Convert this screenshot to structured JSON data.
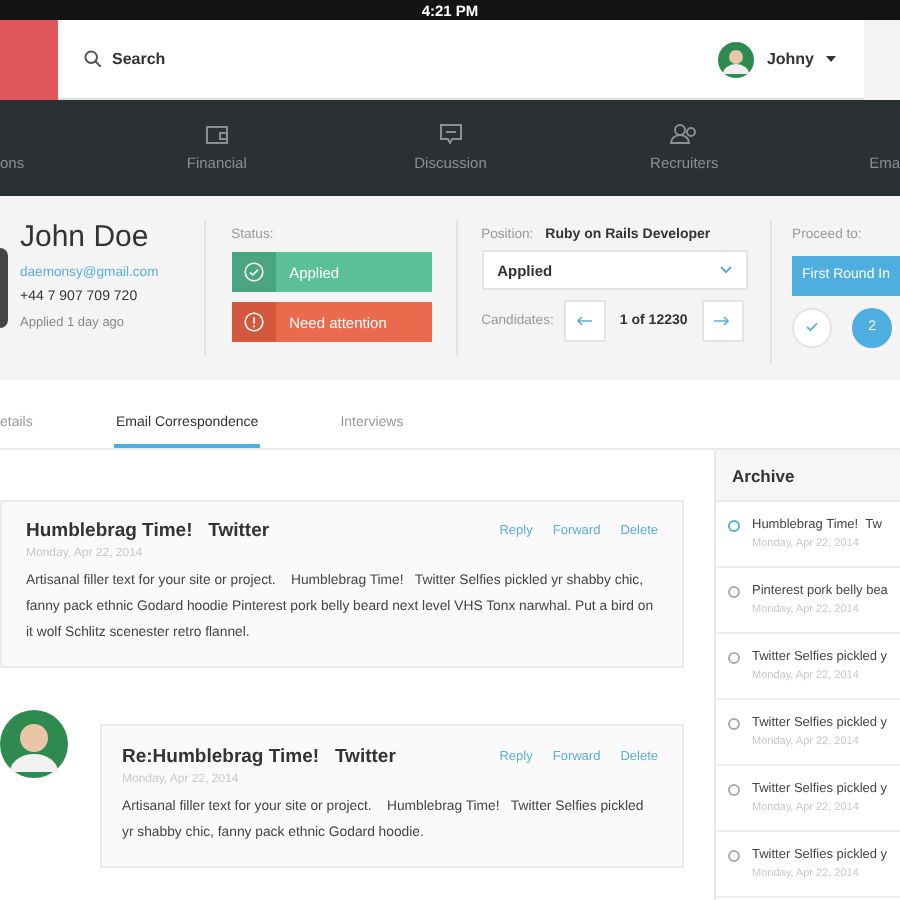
{
  "status_bar": {
    "time": "4:21 PM"
  },
  "header": {
    "search_label": "Search",
    "user_name": "Johny"
  },
  "nav": [
    {
      "label": "ons",
      "kind": "none"
    },
    {
      "label": "Financial",
      "kind": "wallet"
    },
    {
      "label": "Discussion",
      "kind": "chat"
    },
    {
      "label": "Recruiters",
      "kind": "people"
    },
    {
      "label": "Ema",
      "kind": "none"
    }
  ],
  "candidate": {
    "name": "John Doe",
    "email": "daemonsy@gmail.com",
    "phone": "+44 7 907 709 720",
    "applied": "Applied 1 day ago"
  },
  "status": {
    "label": "Status:",
    "options": [
      {
        "label": "Applied",
        "kind": "applied"
      },
      {
        "label": "Need attention",
        "kind": "attention"
      }
    ]
  },
  "position": {
    "label": "Position:",
    "value": "Ruby on Rails Developer",
    "select_value": "Applied",
    "candidates_label": "Candidates:",
    "counter": "1 of 12230"
  },
  "proceed": {
    "label": "Proceed to:",
    "button": "First Round In",
    "steps": [
      {
        "kind": "done"
      },
      {
        "kind": "current",
        "label": "2"
      }
    ]
  },
  "tabs": [
    {
      "label": "etails",
      "selected": false
    },
    {
      "label": "Email Correspondence",
      "selected": true
    },
    {
      "label": "Interviews",
      "selected": false
    }
  ],
  "emails": [
    {
      "subject": "Humblebrag Time!   Twitter",
      "date": "Monday, Apr 22, 2014",
      "body": "Artisanal filler text for your site or project.    Humblebrag Time!   Twitter Selfies pickled yr shabby chic, fanny pack ethnic Godard hoodie Pinterest pork belly beard next level VHS Tonx narwhal. Put a bird on it wolf Schlitz scenester retro flannel.",
      "actions": [
        "Reply",
        "Forward",
        "Delete"
      ],
      "avatar": false
    },
    {
      "subject": "Re:Humblebrag Time!   Twitter",
      "date": "Monday, Apr 22, 2014",
      "body": "Artisanal filler text for your site or project.    Humblebrag Time!   Twitter Selfies pickled yr shabby chic, fanny pack ethnic Godard hoodie.",
      "actions": [
        "Reply",
        "Forward",
        "Delete"
      ],
      "avatar": true
    }
  ],
  "archive": {
    "title": "Archive",
    "items": [
      {
        "subject": "Humblebrag Time!  Tw",
        "date": "Monday, Apr 22, 2014",
        "selected": true
      },
      {
        "subject": "Pinterest pork belly bea",
        "date": "Monday, Apr 22, 2014",
        "selected": false
      },
      {
        "subject": "Twitter Selfies pickled y",
        "date": "Monday, Apr 22, 2014",
        "selected": false
      },
      {
        "subject": "Twitter Selfies pickled y",
        "date": "Monday, Apr 22, 2014",
        "selected": false
      },
      {
        "subject": "Twitter Selfies pickled y",
        "date": "Monday, Apr 22, 2014",
        "selected": false
      },
      {
        "subject": "Twitter Selfies pickled y",
        "date": "Monday, Apr 22, 2014",
        "selected": false
      }
    ]
  }
}
